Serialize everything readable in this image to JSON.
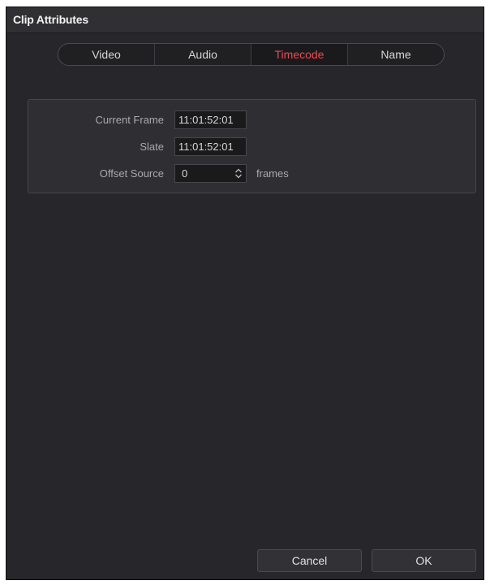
{
  "dialog": {
    "title": "Clip Attributes"
  },
  "tabs": [
    {
      "label": "Video",
      "active": false
    },
    {
      "label": "Audio",
      "active": false
    },
    {
      "label": "Timecode",
      "active": true
    },
    {
      "label": "Name",
      "active": false
    }
  ],
  "timecode": {
    "current_frame": {
      "label": "Current Frame",
      "value": "11:01:52:01"
    },
    "slate": {
      "label": "Slate",
      "value": "11:01:52:01"
    },
    "offset_source": {
      "label": "Offset Source",
      "value": "0",
      "unit": "frames"
    }
  },
  "buttons": {
    "cancel_label": "Cancel",
    "ok_label": "OK"
  },
  "colors": {
    "active_tab": "#ea4a52",
    "background": "#27272b"
  },
  "icons": {
    "stepper": "up-down-chevron-icon"
  }
}
